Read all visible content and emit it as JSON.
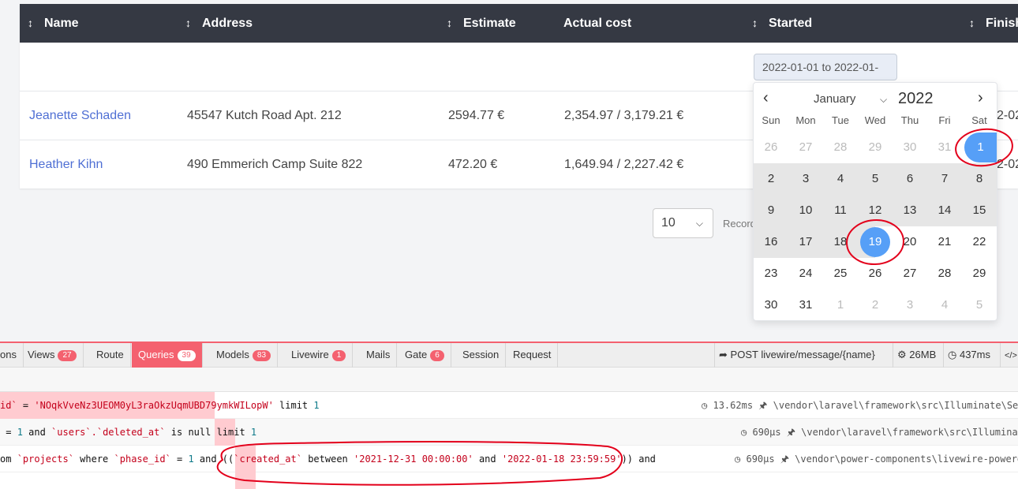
{
  "table": {
    "columns": [
      {
        "label": "Name",
        "sortable": true
      },
      {
        "label": "Address",
        "sortable": true
      },
      {
        "label": "Estimate",
        "sortable": true
      },
      {
        "label": "Actual cost",
        "sortable": false
      },
      {
        "label": "Started",
        "sortable": true
      },
      {
        "label": "Finish",
        "sortable": true
      }
    ],
    "sort_icon": "↕",
    "date_filter_value": "2022-01-01 to 2022-01-",
    "rows": [
      {
        "name": "Jeanette Schaden",
        "address": "45547 Kutch Road Apt. 212",
        "estimate": "2594.77 €",
        "actual": "2,354.97 / 3,179.21 €",
        "finish_fragment": "2-02"
      },
      {
        "name": "Heather Kihn",
        "address": "490 Emmerich Camp Suite 822",
        "estimate": "472.20 €",
        "actual": "1,649.94 / 2,227.42 €",
        "finish_fragment": "2-02"
      }
    ]
  },
  "pagination": {
    "per_page": "10",
    "records_label": "Record"
  },
  "calendar": {
    "prev_icon": "‹",
    "next_icon": "›",
    "month": "January",
    "year": "2022",
    "weekdays": [
      "Sun",
      "Mon",
      "Tue",
      "Wed",
      "Thu",
      "Fri",
      "Sat"
    ],
    "weeks": [
      [
        "26",
        "27",
        "28",
        "29",
        "30",
        "31",
        "1"
      ],
      [
        "2",
        "3",
        "4",
        "5",
        "6",
        "7",
        "8"
      ],
      [
        "9",
        "10",
        "11",
        "12",
        "13",
        "14",
        "15"
      ],
      [
        "16",
        "17",
        "18",
        "19",
        "20",
        "21",
        "22"
      ],
      [
        "23",
        "24",
        "25",
        "26",
        "27",
        "28",
        "29"
      ],
      [
        "30",
        "31",
        "1",
        "2",
        "3",
        "4",
        "5"
      ]
    ],
    "selected_start": "1",
    "selected_end": "19",
    "accent": "#569ff7",
    "range_color": "#e6e6e6"
  },
  "debugbar": {
    "accent": "#f4616f",
    "tabs": [
      {
        "label": "ons",
        "badge": ""
      },
      {
        "label": "Views",
        "badge": "27"
      },
      {
        "label": "Route",
        "badge": ""
      },
      {
        "label": "Queries",
        "badge": "39",
        "active": true
      },
      {
        "label": "Models",
        "badge": "83"
      },
      {
        "label": "Livewire",
        "badge": "1"
      },
      {
        "label": "Mails",
        "badge": ""
      },
      {
        "label": "Gate",
        "badge": "6"
      },
      {
        "label": "Session",
        "badge": ""
      },
      {
        "label": "Request",
        "badge": ""
      }
    ],
    "right": {
      "method": "POST",
      "route_a": "livewire",
      "route_b": "message",
      "route_c": "{name}",
      "memory": "26MB",
      "time": "437ms",
      "code_icon": "</>"
    },
    "queries": [
      {
        "p1": "id`",
        "p2": " = ",
        "p3": "'NOqkVveNz3UEOM0yL3raOkzUqmUBD79ymkWILopW'",
        "p4": " limit ",
        "p5": "1",
        "duration": "13.62ms",
        "source": "\\vendor\\laravel\\framework\\src\\Illuminate\\Ses"
      },
      {
        "p1": " = ",
        "p2": "1",
        "p3": " and ",
        "p4": "`users`.`deleted_at`",
        "p5": " is null ",
        "p6": "limit",
        "p7": " 1",
        "duration": "690μs",
        "source": "\\vendor\\laravel\\framework\\src\\Illuminat"
      },
      {
        "p1": "om ",
        "p2": "`projects`",
        "p3": " where ",
        "p4": "`phase_id`",
        "p5": " = ",
        "p6": "1",
        "p7": " and ((",
        "p8": "`created_at`",
        "p9": " between ",
        "p10": "'2021-12-31 00:00:00'",
        "p11": " and ",
        "p12": "'2022-01-18 23:59:59'",
        "p13": ")) and",
        "duration": "690μs",
        "source": "\\vendor\\power-components\\livewire-powerg"
      }
    ]
  }
}
